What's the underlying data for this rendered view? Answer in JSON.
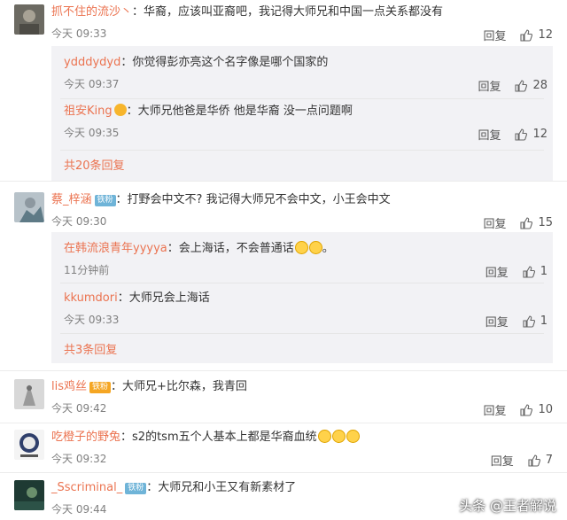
{
  "comments": [
    {
      "user": "抓不住的流沙丶",
      "text": "华裔，应该叫亚裔吧，我记得大师兄和中国一点关系都没有",
      "time": "今天 09:33",
      "reply": "回复",
      "likes": "12",
      "replies": [
        {
          "user": "ydddydyd",
          "text": "你觉得彭亦亮这个名字像是哪个国家的",
          "time": "今天 09:37",
          "reply": "回复",
          "likes": "28"
        },
        {
          "user": "祖安King",
          "text": "大师兄他爸是华侨 他是华裔 没一点问题啊",
          "time": "今天 09:35",
          "reply": "回复",
          "likes": "12"
        }
      ],
      "more": "共20条回复"
    },
    {
      "user": "蔡_梓涵",
      "badge": "铁粉",
      "text": "打野会中文不? 我记得大师兄不会中文，小王会中文",
      "time": "今天 09:30",
      "reply": "回复",
      "likes": "15",
      "replies": [
        {
          "user": "在韩流浪青年yyyya",
          "text": "会上海话，不会普通话",
          "time": "11分钟前",
          "reply": "回复",
          "likes": "1"
        },
        {
          "user": "kkumdori",
          "text": "大师兄会上海话",
          "time": "今天 09:33",
          "reply": "回复",
          "likes": "1"
        }
      ],
      "more": "共3条回复"
    },
    {
      "user": "lis鸡丝",
      "badge": "铁粉",
      "text": "大师兄+比尔森，我青回",
      "time": "今天 09:42",
      "reply": "回复",
      "likes": "10"
    },
    {
      "user": "吃橙子的野兔",
      "text": "s2的tsm五个人基本上都是华裔血统",
      "time": "今天 09:32",
      "reply": "回复",
      "likes": "7"
    },
    {
      "user": "_Sscriminal_",
      "badge": "铁粉",
      "text": "大师兄和小王又有新素材了",
      "time": "今天 09:44"
    }
  ],
  "watermark": "头条 @王者解说",
  "colors": {
    "username": "#eb7350",
    "reply_bg": "#f2f2f5",
    "badge_blue": "#6fb4d8"
  },
  "icons": {
    "like": "thumbs-up-icon"
  }
}
